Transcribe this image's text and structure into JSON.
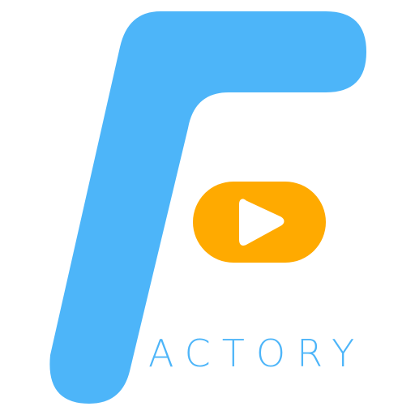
{
  "logo": {
    "wordmark": "ACTORY",
    "colors": {
      "letter_f": "#4DB5F9",
      "play_button": "#FFAA00",
      "play_triangle": "#FFFFFF",
      "wordmark": "#4DB5F9",
      "background": "#FFFFFF"
    },
    "icons": [
      "letter-f-icon",
      "play-button-icon"
    ]
  }
}
